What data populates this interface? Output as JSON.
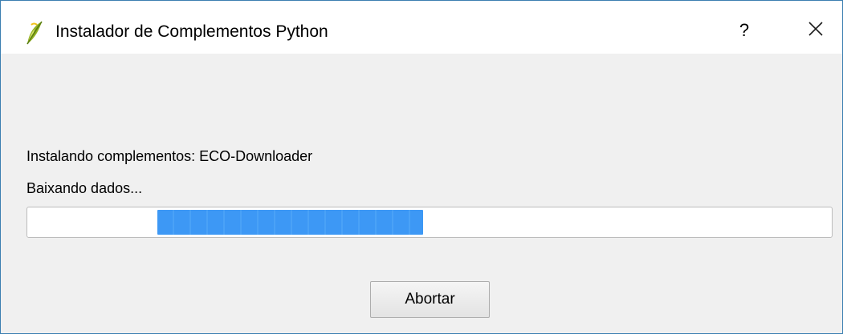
{
  "window": {
    "title": "Instalador de Complementos Python",
    "icon": "qgis-logo-icon",
    "help_label": "?",
    "close_icon": "close-icon"
  },
  "status": {
    "installing_line": "Instalando complementos:  ECO-Downloader",
    "download_line": "Baixando dados..."
  },
  "progress": {
    "mode": "indeterminate",
    "accent_color": "#3d98f5"
  },
  "buttons": {
    "abort_label": "Abortar"
  }
}
